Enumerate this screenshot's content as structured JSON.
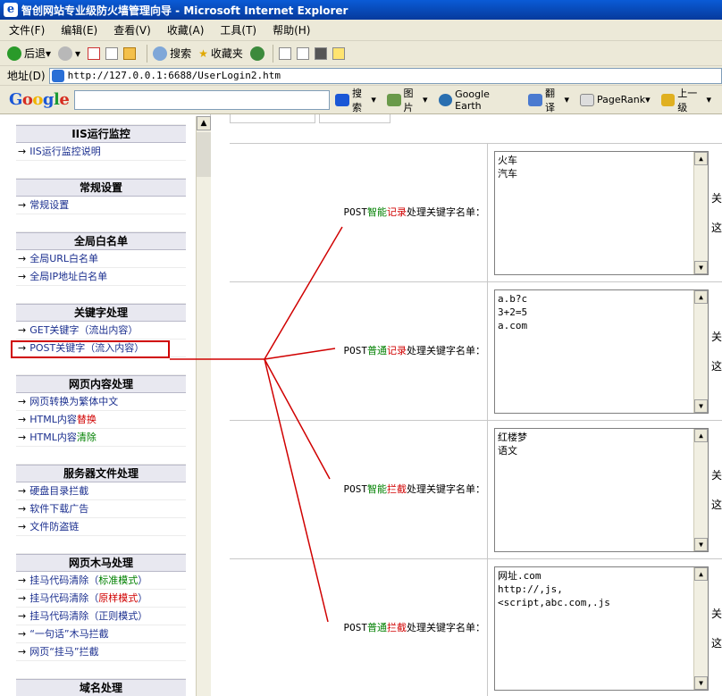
{
  "window": {
    "title": "智创网站专业级防火墙管理向导 - Microsoft Internet Explorer"
  },
  "menu": [
    "文件(F)",
    "编辑(E)",
    "查看(V)",
    "收藏(A)",
    "工具(T)",
    "帮助(H)"
  ],
  "toolbar": {
    "back": "后退",
    "search": "搜索",
    "favorites": "收藏夹"
  },
  "address": {
    "label": "地址(D)",
    "url": "http://127.0.0.1:6688/UserLogin2.htm"
  },
  "google": {
    "logo": "Google",
    "search": "搜索",
    "images": "图片",
    "earth": "Google Earth",
    "translate": "翻译",
    "pagerank": "PageRank",
    "up": "上一级"
  },
  "nav": {
    "s1": {
      "head": "IIS运行监控",
      "i1": "IIS运行监控说明"
    },
    "s2": {
      "head": "常规设置",
      "i1": "常规设置"
    },
    "s3": {
      "head": "全局白名单",
      "i1": "全局URL白名单",
      "i2": "全局IP地址白名单"
    },
    "s4": {
      "head": "关键字处理",
      "i1": "GET关键字（流出内容）",
      "i2": "POST关键字（流入内容）"
    },
    "s5": {
      "head": "网页内容处理",
      "i1": "网页转换为繁体中文",
      "i2a": "HTML内容",
      "i2b": "替换",
      "i3a": "HTML内容",
      "i3b": "清除"
    },
    "s6": {
      "head": "服务器文件处理",
      "i1": "硬盘目录拦截",
      "i2": "软件下载广告",
      "i3": "文件防盗链"
    },
    "s7": {
      "head": "网页木马处理",
      "i1a": "挂马代码清除（",
      "i1b": "标准模式",
      "i1c": "）",
      "i2a": "挂马代码清除（",
      "i2b": "原样模式",
      "i2c": "）",
      "i3": "挂马代码清除（正则模式）",
      "i4": "“一句话”木马拦截",
      "i5": "网页“挂马”拦截"
    },
    "s8": {
      "head": "域名处理"
    }
  },
  "rows": [
    {
      "l1": "POST",
      "l2": "智能",
      "l3": "记录",
      "l4": "处理关键字名单：",
      "text": "火车\n汽车",
      "side1": "关",
      "side2": "这"
    },
    {
      "l1": "POST",
      "l2": "普通",
      "l3": "记录",
      "l4": "处理关键字名单：",
      "text": "a.b?c\n3+2=5\na.com",
      "side1": "关",
      "side2": "这"
    },
    {
      "l1": "POST",
      "l2": "智能",
      "l3": "拦截",
      "l4": "处理关键字名单：",
      "text": "红楼梦\n语文",
      "side1": "关",
      "side2": "这"
    },
    {
      "l1": "POST",
      "l2": "普通",
      "l3": "拦截",
      "l4": "处理关键字名单：",
      "text": "网址.com\nhttp://,js,\n<script,abc.com,.js",
      "side1": "关",
      "side2": "这"
    }
  ],
  "colors": {
    "highlight": "#d00000",
    "link": "#1b2f8f",
    "green": "#008000"
  }
}
